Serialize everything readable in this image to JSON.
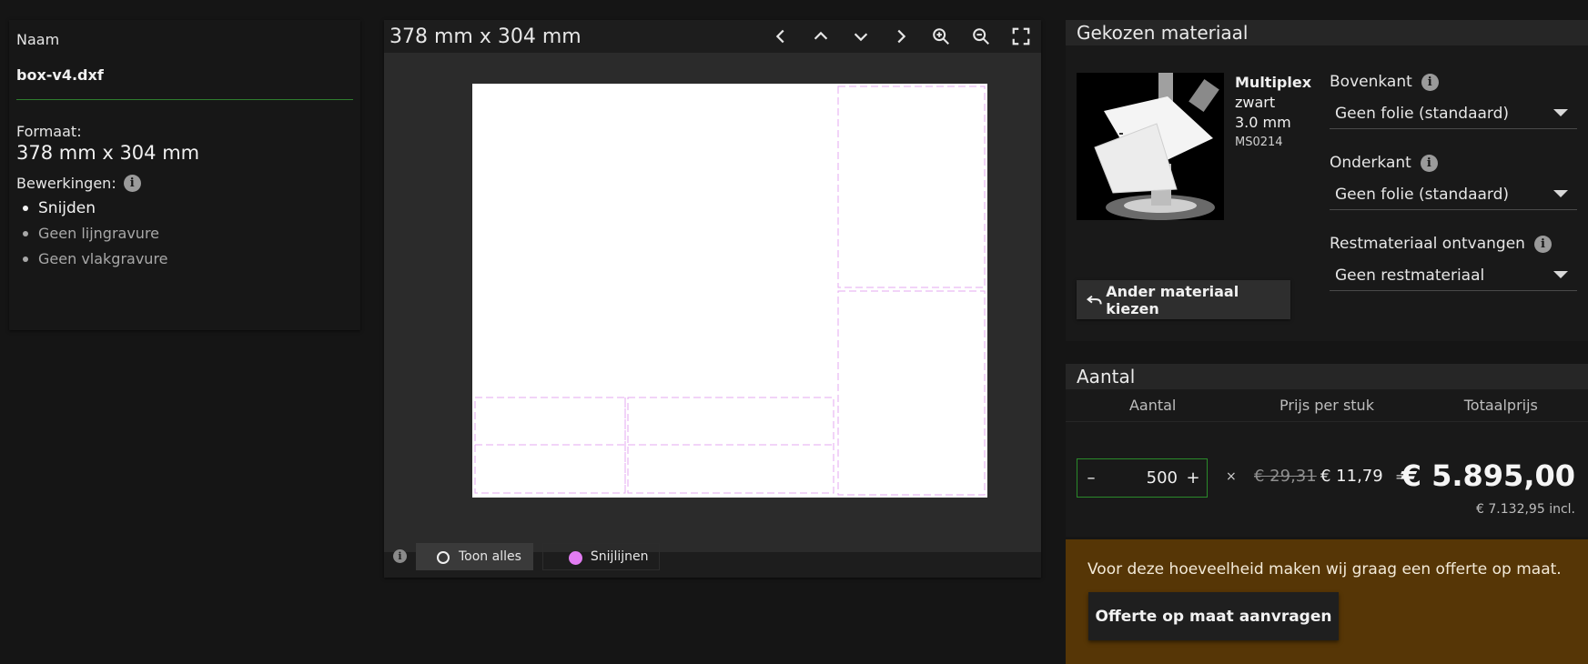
{
  "file": {
    "name_label": "Naam",
    "name": "box-v4.dxf",
    "format_label": "Formaat:",
    "format_value": "378 mm x 304 mm",
    "operations_label": "Bewerkingen:",
    "operations": [
      "Snijden",
      "Geen lijngravure",
      "Geen vlakgravure"
    ]
  },
  "viewer": {
    "title": "378 mm x 304 mm",
    "tools": [
      "chevron-left-icon",
      "chevron-up-icon",
      "chevron-down-icon",
      "chevron-right-icon",
      "zoom-in-icon",
      "zoom-out-icon",
      "fullscreen-icon"
    ],
    "footer": {
      "show_all": "Toon alles",
      "cut_lines": "Snijlijnen"
    },
    "cut_line_color": "#e27cf2"
  },
  "material": {
    "header": "Gekozen materiaal",
    "name": "Multiplex",
    "color": "zwart",
    "thickness": "3.0 mm",
    "code": "MS0214",
    "change_button": "Ander materiaal kiezen",
    "top": {
      "label": "Bovenkant",
      "value": "Geen folie (standaard)"
    },
    "bottom": {
      "label": "Onderkant",
      "value": "Geen folie (standaard)"
    },
    "rest": {
      "label": "Restmateriaal ontvangen",
      "value": "Geen restmateriaal"
    }
  },
  "quantity": {
    "header": "Aantal",
    "col_qty": "Aantal",
    "col_price": "Prijs per stuk",
    "col_total": "Totaalprijs",
    "minus": "–",
    "plus": "+",
    "value": "500",
    "times": "×",
    "old_price": "€ 29,31",
    "price": "€ 11,79",
    "equals": "=",
    "total": "€ 5.895,00",
    "total_incl": "€ 7.132,95 incl."
  },
  "offer": {
    "text": "Voor deze hoeveelheid maken wij graag een offerte op maat.",
    "button": "Offerte op maat aanvragen",
    "bg_color": "#563606"
  }
}
